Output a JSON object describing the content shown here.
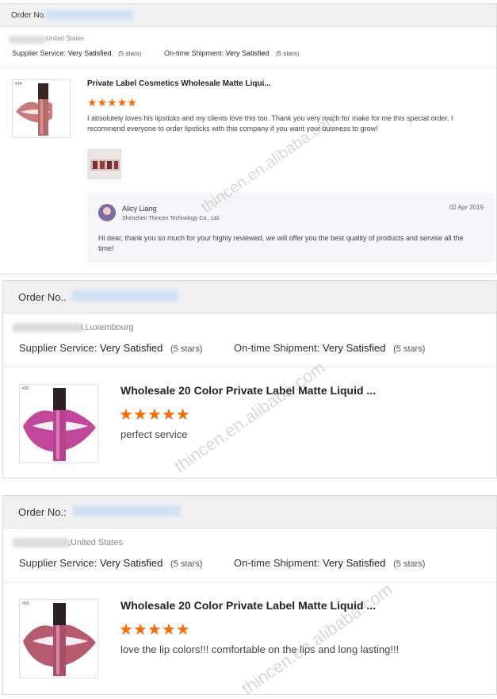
{
  "reviews": [
    {
      "order_label": "Order No.",
      "location": "United States",
      "supplier_service_label": "Supplier Service:",
      "supplier_service_value": "Very Satisfied",
      "supplier_service_stars": "(5 stars)",
      "shipment_label": "On-time Shipment:",
      "shipment_value": "Very Satisfied",
      "shipment_stars": "(5 stars)",
      "product_number": "#14",
      "product_title": "Private Label Cosmetics Wholesale Matte Liqui...",
      "rating": 5,
      "comment": "I absolutely loves his lipsticks and my clients love this too. Thank you very much for make for me this special order. I recommend everyone to order lipsticks with this company if you want your business to grow!",
      "reply": {
        "author": "Alicy Liang",
        "company": "Shenzhen Thincen Technology Co., Ltd.",
        "date": "02 Apr 2019",
        "text": "Hi dear, thank you so much for your highly reviewed, we will offer you the best quality of products and servise all the time!"
      }
    },
    {
      "order_label": "Order No..",
      "location": "i,Luxembourg",
      "supplier_service_label": "Supplier Service:",
      "supplier_service_value": "Very Satisfied",
      "supplier_service_stars": "(5 stars)",
      "shipment_label": "On-time Shipment:",
      "shipment_value": "Very Satisfied",
      "shipment_stars": "(5 stars)",
      "product_number": "#20",
      "product_title": "Wholesale 20 Color Private Label Matte Liquid ...",
      "rating": 5,
      "comment": "perfect service"
    },
    {
      "order_label": "Order No.:",
      "location": ",United States",
      "supplier_service_label": "Supplier Service:",
      "supplier_service_value": "Very Satisfied",
      "supplier_service_stars": "(5 stars)",
      "shipment_label": "On-time Shipment:",
      "shipment_value": "Very Satisfied",
      "shipment_stars": "(5 stars)",
      "product_number": "#03",
      "product_title": "Wholesale 20 Color Private Label Matte Liquid ...",
      "rating": 5,
      "comment": "love the lip colors!!! comfortable on the lips and long lasting!!!"
    }
  ],
  "watermark": "thincen.en.alibaba.com",
  "colors": {
    "star": "#ff6a00",
    "header_bg": "#f1f1f1",
    "lip_1": "#c87a7a",
    "lip_2": "#c2479a",
    "lip_3": "#b65a6e"
  }
}
